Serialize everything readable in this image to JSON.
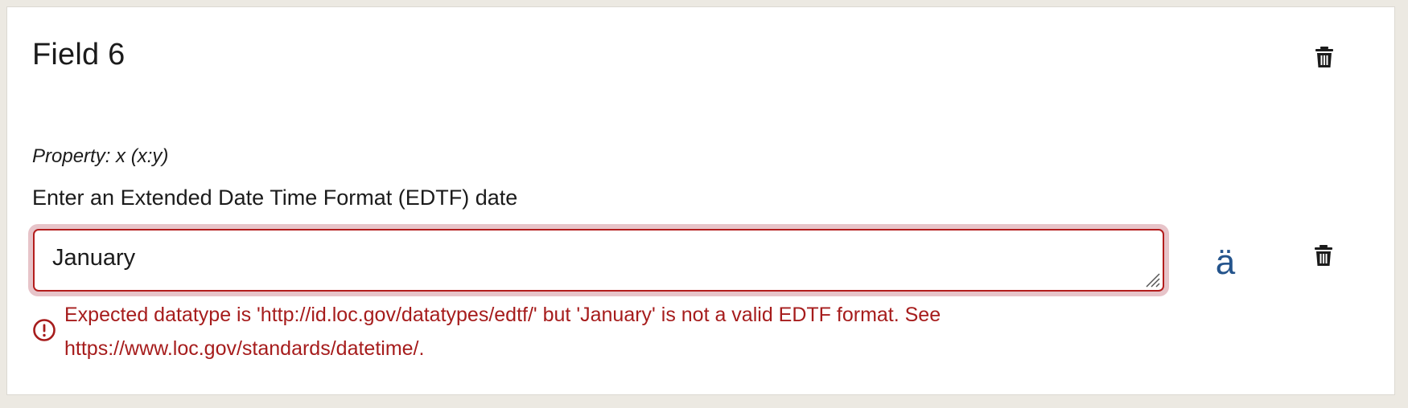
{
  "field": {
    "title": "Field 6",
    "property_line": "Property: x (x:y)",
    "instruction": "Enter an Extended Date Time Format (EDTF) date",
    "value": "January",
    "diacritic_label": "ä",
    "error_message": "Expected datatype is 'http://id.loc.gov/datatypes/edtf/' but 'January' is not a valid EDTF format. See https://www.loc.gov/standards/datetime/."
  },
  "icons": {
    "delete_field": "trash-icon",
    "delete_value": "trash-icon",
    "error": "exclamation-circle-icon",
    "resize": "resize-grip-icon"
  },
  "colors": {
    "error": "#a61c1c",
    "input_border": "#b31d1d",
    "focus_ring": "#e7c4c9",
    "diacritic": "#24548c"
  }
}
